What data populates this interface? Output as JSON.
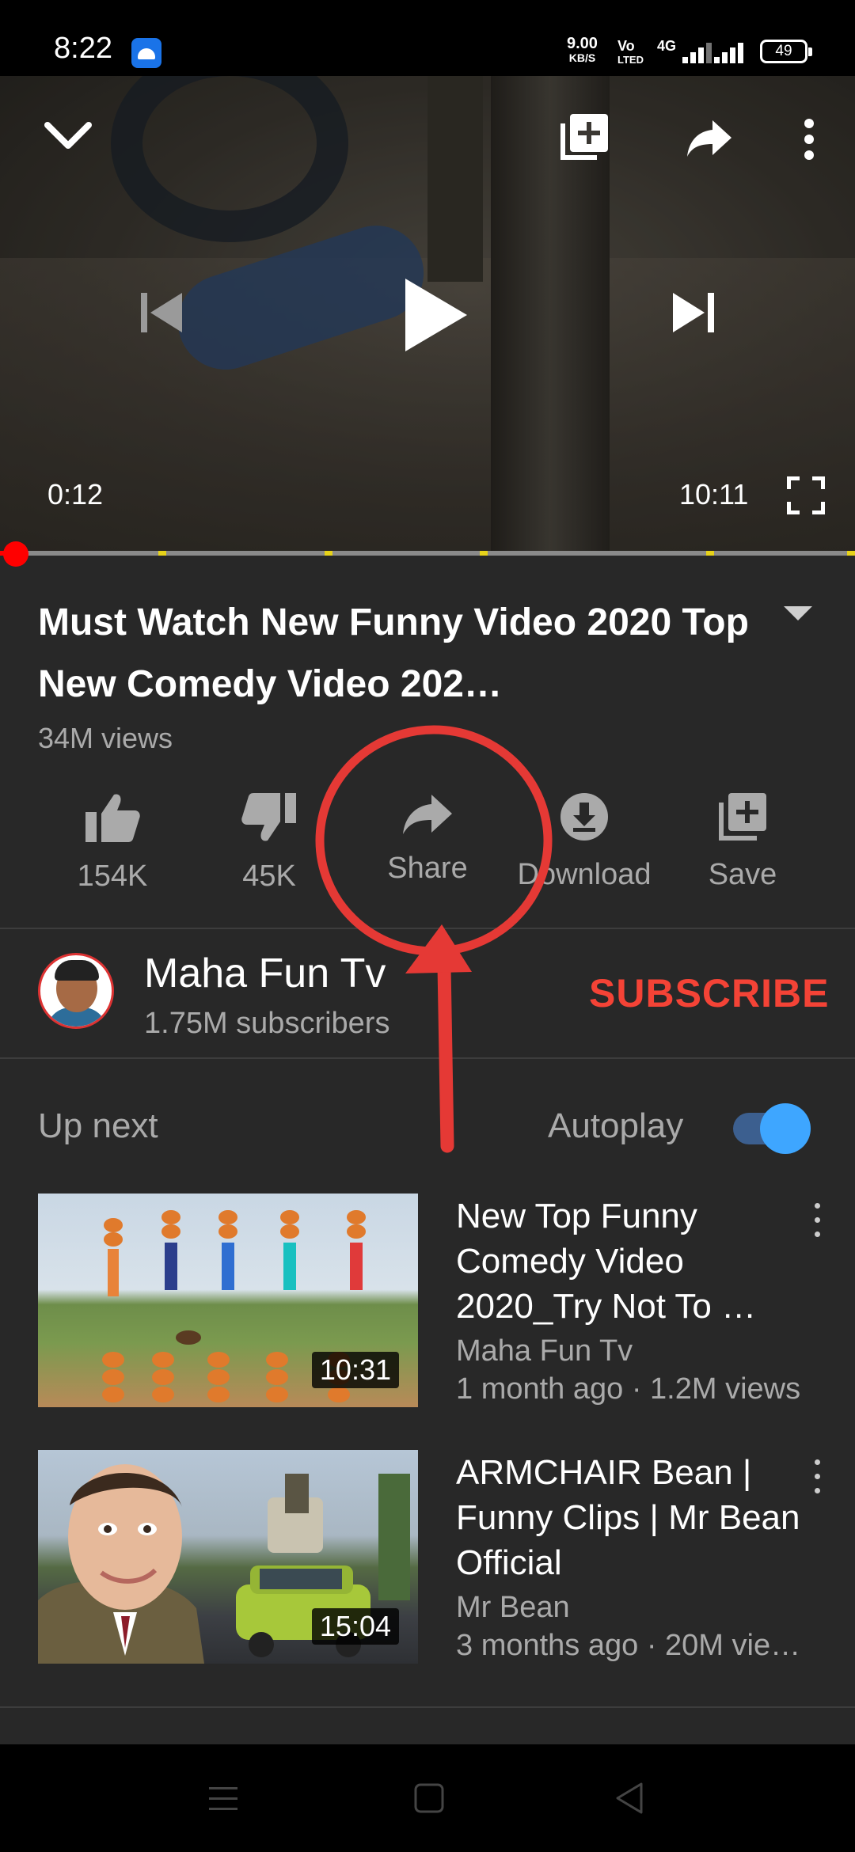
{
  "status_bar": {
    "time": "8:22",
    "net_speed_value": "9.00",
    "net_speed_unit": "KB/S",
    "volte_top": "Vo",
    "volte_bottom": "LTED",
    "network_type": "4G",
    "battery": "49"
  },
  "player": {
    "current_time": "0:12",
    "total_time": "10:11",
    "progress": 0.02
  },
  "video": {
    "title": "Must Watch New Funny Video 2020 Top New Comedy Video 202…",
    "views": "34M views"
  },
  "actions": {
    "like_count": "154K",
    "dislike_count": "45K",
    "share_label": "Share",
    "download_label": "Download",
    "save_label": "Save"
  },
  "channel": {
    "name": "Maha Fun Tv",
    "subscribers": "1.75M subscribers",
    "subscribe_label": "SUBSCRIBE"
  },
  "up_next": {
    "label": "Up next",
    "autoplay_label": "Autoplay",
    "autoplay_on": true,
    "items": [
      {
        "title": "New Top Funny Comedy Video 2020_Try Not To …",
        "channel": "Maha Fun Tv",
        "meta": "1 month ago · 1.2M views",
        "duration": "10:31"
      },
      {
        "title": "ARMCHAIR Bean | Funny Clips | Mr Bean Official",
        "channel": "Mr Bean",
        "meta": "3 months ago · 20M vie…",
        "duration": "15:04"
      }
    ]
  },
  "annotation": {
    "color": "#e53935"
  }
}
